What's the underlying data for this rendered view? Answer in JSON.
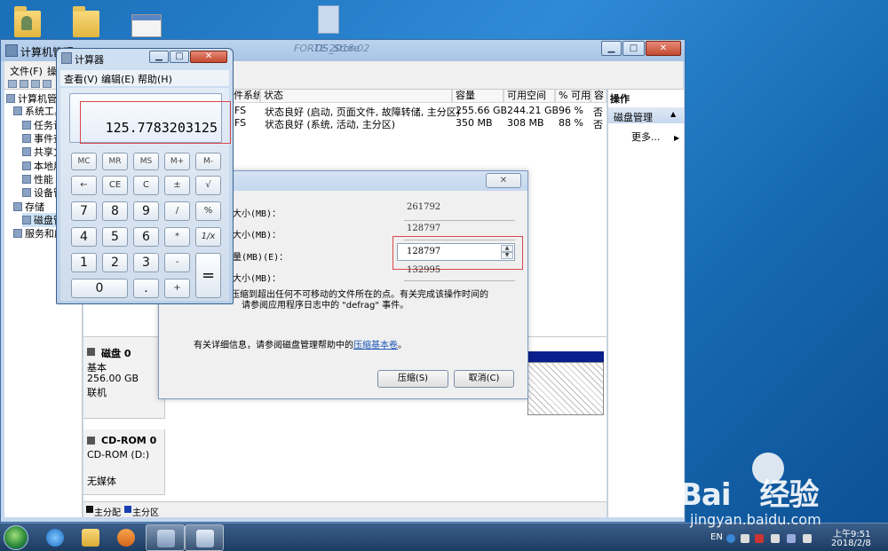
{
  "desktop": {
    "icons": [
      {
        "name": "user-folder"
      },
      {
        "name": "folder"
      },
      {
        "name": "screenshot-doc"
      },
      {
        "name": "ds-store-file"
      }
    ],
    "ds_store_label": ".DS_Store"
  },
  "computer_management": {
    "title": "计算机管理",
    "faded_title": "FORTE    2018.02",
    "buttons": {
      "minimize": "▁",
      "maximize": "□",
      "close": "✕"
    },
    "menu": [
      "文件(F)",
      "操"
    ],
    "tree": [
      "计算机管理",
      "系统工具",
      "任务计",
      "事件查",
      "共享文",
      "本地用",
      "性能",
      "设备管",
      "存储",
      "磁盘管",
      "服务和应"
    ],
    "columns": [
      "件系统",
      "状态",
      "容量",
      "可用空间",
      "% 可用",
      "容"
    ],
    "volumes": [
      {
        "fs": "FS",
        "status": "状态良好 (启动, 页面文件, 故障转储, 主分区)",
        "capacity": "255.66 GB",
        "free": "244.21 GB",
        "pct": "96 %",
        "fault": "否"
      },
      {
        "fs": "FS",
        "status": "状态良好 (系统, 活动, 主分区)",
        "capacity": "350 MB",
        "free": "308 MB",
        "pct": "88 %",
        "fault": "否"
      }
    ],
    "disks": [
      {
        "name": "磁盘 0",
        "type": "基本",
        "size": "256.00 GB",
        "status": "联机"
      },
      {
        "name": "CD-ROM 0",
        "type": "CD-ROM (D:)",
        "size": "",
        "status": "无媒体"
      }
    ],
    "legend": [
      "主分配",
      "主分区"
    ],
    "actions": {
      "header": "操作",
      "section": "磁盘管理",
      "more": "更多..."
    }
  },
  "shrink_dialog": {
    "close": "✕",
    "rows": [
      {
        "label": "大小(MB)：",
        "value": "261792"
      },
      {
        "label": "大小(MB)：",
        "value": "128797"
      },
      {
        "label": "量(MB)(E)：",
        "value": "128797"
      },
      {
        "label": "大小(MB)：",
        "value": "132995"
      }
    ],
    "note_line1": "压缩到超出任何不可移动的文件所在的点。有关完成该操作时间的",
    "note_line2": "请参阅应用程序日志中的 \"defrag\" 事件。",
    "help_text": "有关详细信息，请参阅磁盘管理帮助中的",
    "help_link": "压缩基本卷",
    "help_period": "。",
    "shrink_button": "压缩(S)",
    "cancel_button": "取消(C)"
  },
  "calculator": {
    "title": "计算器",
    "buttons_close": "✕",
    "menu": [
      "查看(V)",
      "编辑(E)",
      "帮助(H)"
    ],
    "display": "125.7783203125",
    "memory_keys": [
      "MC",
      "MR",
      "MS",
      "M+",
      "M-"
    ],
    "row2": [
      "←",
      "CE",
      "C",
      "±",
      "√"
    ],
    "row3": [
      "7",
      "8",
      "9",
      "/",
      "%"
    ],
    "row4": [
      "4",
      "5",
      "6",
      "*",
      "1/x"
    ],
    "row5": [
      "1",
      "2",
      "3",
      "-"
    ],
    "row6": [
      "0",
      ".",
      "+"
    ],
    "equals": "="
  },
  "taskbar": {
    "lang": "EN",
    "time": "上午9:51",
    "date": "2018/2/8"
  },
  "watermark": {
    "main": "Bai　经验",
    "sub": "jingyan.baidu.com"
  },
  "colors": {
    "accent": "#2f8ad6",
    "highlight_red": "#d8474a",
    "disk_bar": "#0a1f8c"
  }
}
